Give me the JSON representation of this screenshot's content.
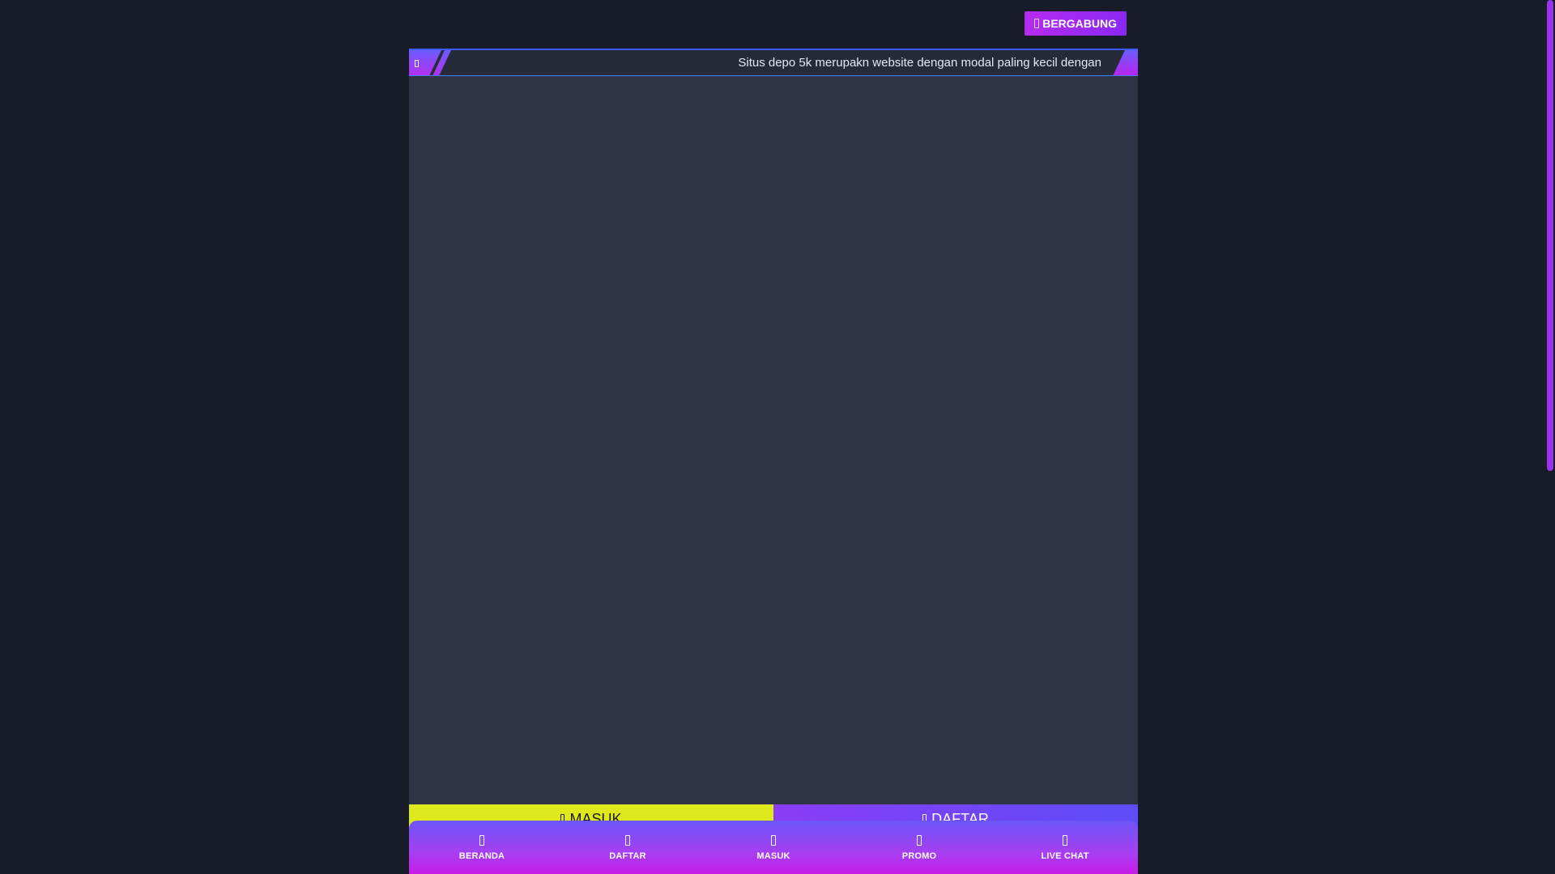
{
  "header": {
    "join_label": "BERGABUNG",
    "join_icon": "user-plus-icon"
  },
  "ticker": {
    "icon": "speaker-icon",
    "text": "Situs depo 5k merupakn website dengan modal paling kecil dengan"
  },
  "actions": {
    "masuk_label": "MASUK",
    "daftar_label": "DAFTAR"
  },
  "bottom_nav": {
    "items": [
      {
        "label": "BERANDA",
        "icon": "home-icon"
      },
      {
        "label": "DAFTAR",
        "icon": "user-add-icon"
      },
      {
        "label": "MASUK",
        "icon": "login-icon"
      },
      {
        "label": "PROMO",
        "icon": "gift-icon"
      },
      {
        "label": "LIVE CHAT",
        "icon": "chat-icon"
      }
    ]
  },
  "colors": {
    "background": "#171c28",
    "panel": "#2e3445",
    "accent_purple": "#9a33ee",
    "accent_yellow": "#dfe81a",
    "accent_blue": "#3a5cff"
  }
}
